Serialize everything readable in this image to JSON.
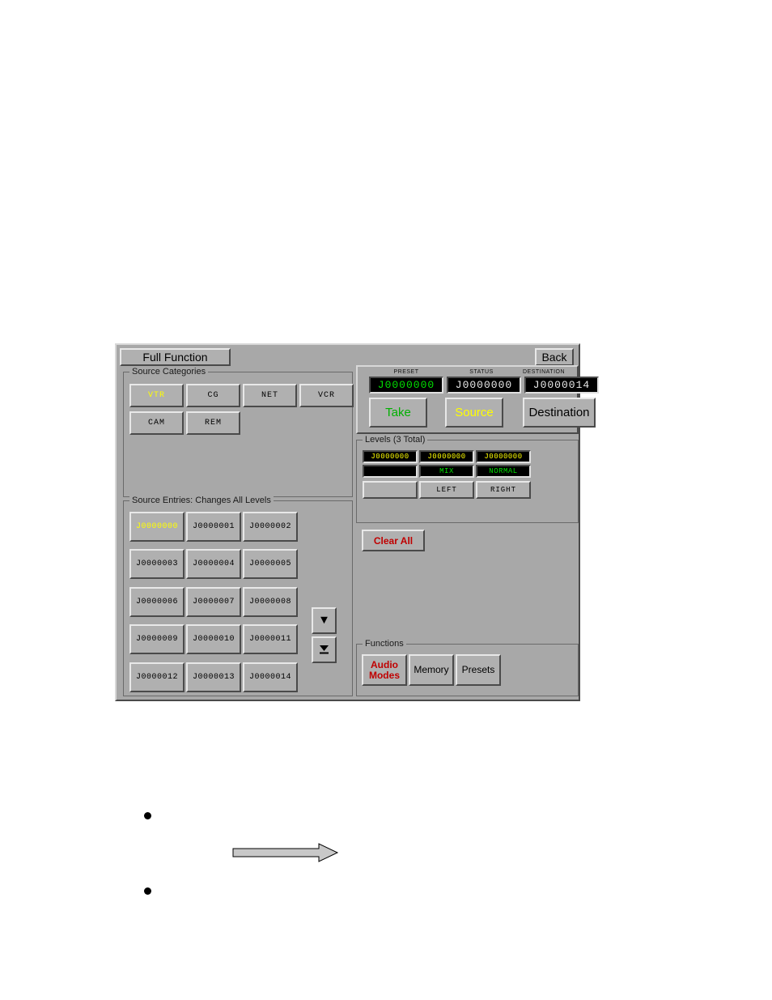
{
  "titlebar": {
    "title": "Full Function",
    "back_label": "Back"
  },
  "source_categories": {
    "legend": "Source Categories",
    "items": [
      {
        "label": "VTR",
        "selected": true
      },
      {
        "label": "CG",
        "selected": false
      },
      {
        "label": "NET",
        "selected": false
      },
      {
        "label": "VCR",
        "selected": false
      },
      {
        "label": "CAM",
        "selected": false
      },
      {
        "label": "REM",
        "selected": false
      }
    ]
  },
  "source_entries": {
    "legend": "Source Entries: Changes All Levels",
    "items": [
      {
        "label": "J0000000",
        "selected": true
      },
      {
        "label": "J0000001",
        "selected": false
      },
      {
        "label": "J0000002",
        "selected": false
      },
      {
        "label": "J0000003",
        "selected": false
      },
      {
        "label": "J0000004",
        "selected": false
      },
      {
        "label": "J0000005",
        "selected": false
      },
      {
        "label": "J0000006",
        "selected": false
      },
      {
        "label": "J0000007",
        "selected": false
      },
      {
        "label": "J0000008",
        "selected": false
      },
      {
        "label": "J0000009",
        "selected": false
      },
      {
        "label": "J0000010",
        "selected": false
      },
      {
        "label": "J0000011",
        "selected": false
      },
      {
        "label": "J0000012",
        "selected": false
      },
      {
        "label": "J0000013",
        "selected": false
      },
      {
        "label": "J0000014",
        "selected": false
      }
    ],
    "scroll_down_label": "▼",
    "scroll_end_label": "▼"
  },
  "readouts": {
    "preset_label": "PRESET",
    "status_label": "STATUS",
    "destination_label": "DESTINATION",
    "preset_value": "J0000000",
    "status_value": "J0000000",
    "destination_value": "J0000014",
    "take_label": "Take",
    "source_label": "Source",
    "destination_button_label": "Destination"
  },
  "levels": {
    "legend": "Levels (3 Total)",
    "columns": [
      {
        "top": "J0000000",
        "middle": "",
        "button": ""
      },
      {
        "top": "J0000000",
        "middle": "MIX",
        "button": "LEFT"
      },
      {
        "top": "J0000000",
        "middle": "NORMAL",
        "button": "RIGHT"
      }
    ],
    "clear_all_label": "Clear All"
  },
  "functions": {
    "legend": "Functions",
    "items": [
      {
        "line1": "Audio",
        "line2": "Modes"
      },
      {
        "line1": "Memory",
        "line2": ""
      },
      {
        "line1": "Presets",
        "line2": ""
      }
    ]
  },
  "colors": {
    "panel": "#a8a8a8",
    "lcd_green": "#00e000",
    "lcd_yellow": "#ffff00",
    "accent_red": "#c00000"
  }
}
